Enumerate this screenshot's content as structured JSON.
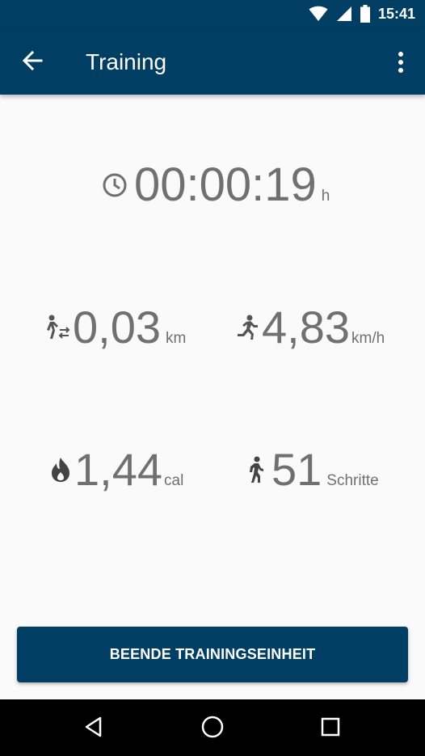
{
  "status_bar": {
    "time": "15:41",
    "icons": [
      "wifi-icon",
      "signal-icon",
      "battery-icon"
    ]
  },
  "app_bar": {
    "title": "Training",
    "back_icon": "arrow-back-icon",
    "menu_icon": "more-vert-icon"
  },
  "metrics": {
    "duration": {
      "icon": "clock-icon",
      "value": "00:00:19",
      "unit": "h"
    },
    "distance": {
      "icon": "walking-distance-icon",
      "value": "0,03",
      "unit": "km"
    },
    "speed": {
      "icon": "running-icon",
      "value": "4,83",
      "unit": "km/h"
    },
    "calories": {
      "icon": "flame-icon",
      "value": "1,44",
      "unit": "cal"
    },
    "steps": {
      "icon": "walking-icon",
      "value": "51",
      "unit": "Schritte"
    }
  },
  "actions": {
    "finish_label": "BEENDE TRAININGSEINHEIT"
  },
  "nav_bar": {
    "icons": [
      "back-triangle-icon",
      "home-circle-icon",
      "recents-square-icon"
    ]
  },
  "colors": {
    "primary": "#003e63",
    "metric_text": "#707070",
    "background": "#fafafa"
  }
}
